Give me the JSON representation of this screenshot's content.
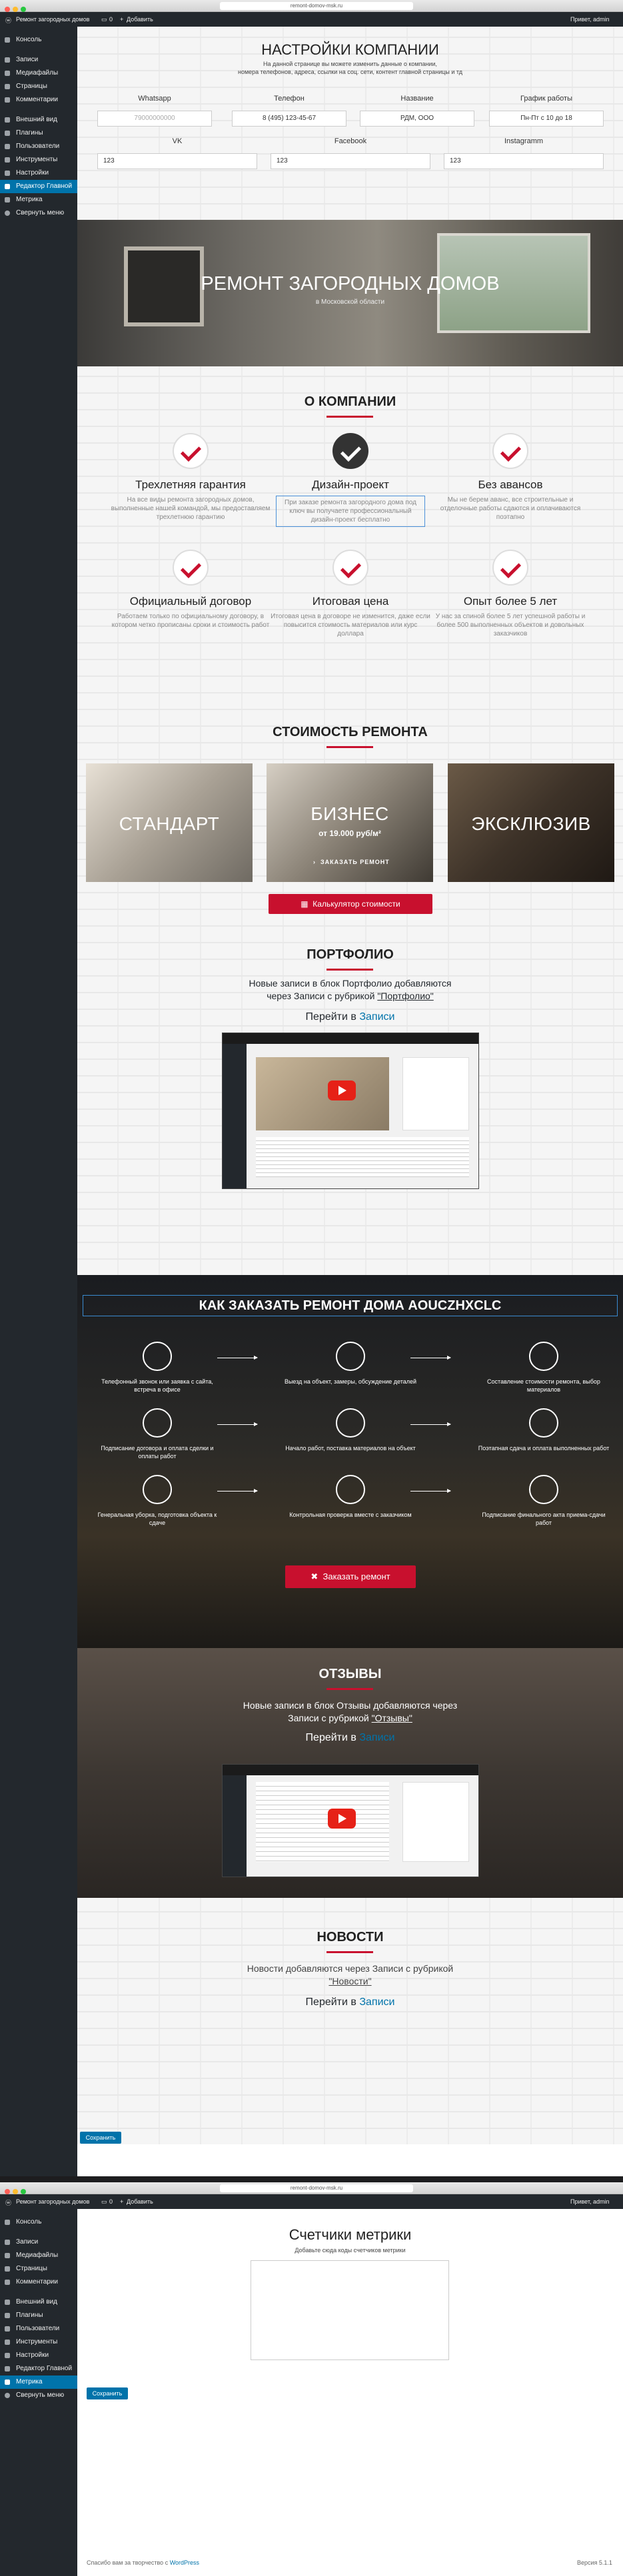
{
  "browser": {
    "url_top": "remont-domov-msk.ru",
    "url_bottom": "remont-domov-msk.ru"
  },
  "adminbar": {
    "site": "Ремонт загородных домов",
    "comments": "0",
    "add": "Добавить",
    "greeting": "Привет, admin"
  },
  "sidebar": {
    "items": [
      "Консоль",
      "Записи",
      "Медиафайлы",
      "Страницы",
      "Комментарии",
      "Внешний вид",
      "Плагины",
      "Пользователи",
      "Инструменты",
      "Настройки",
      "Редактор Главной",
      "Метрика",
      "Свернуть меню"
    ],
    "active_top": "Редактор Главной",
    "active_bottom": "Метрика"
  },
  "settings": {
    "title": "НАСТРОЙКИ КОМПАНИИ",
    "desc1": "На данной странице вы можете изменить данные о компании,",
    "desc2": "номера телефонов, адреса, ссылки на соц. сети, контент главной страницы и тд",
    "labels": [
      "Whatsapp",
      "Телефон",
      "Название",
      "График работы"
    ],
    "values": [
      "79000000000",
      "8 (495) 123-45-67",
      "РДМ, ООО",
      "Пн-Пт с 10 до 18"
    ],
    "social_labels": [
      "VK",
      "Facebook",
      "Instagramm"
    ],
    "social_values": [
      "123",
      "123",
      "123"
    ]
  },
  "hero": {
    "title": "РЕМОНТ ЗАГОРОДНЫХ ДОМОВ",
    "subtitle": "в Московской области"
  },
  "about": {
    "title": "О КОМПАНИИ",
    "features": [
      {
        "title": "Трехлетняя гарантия",
        "text": "На все виды ремонта загородных домов, выполненные нашей командой, мы предоставляем трехлетнюю гарантию"
      },
      {
        "title": "Дизайн-проект",
        "text": "При заказе ремонта загородного дома под ключ вы получаете профессиональный дизайн-проект бесплатно"
      },
      {
        "title": "Без авансов",
        "text": "Мы не берем аванс, все строительные и отделочные работы сдаются и оплачиваются поэтапно"
      },
      {
        "title": "Официальный договор",
        "text": "Работаем только по официальному договору, в котором четко прописаны сроки и стоимость работ"
      },
      {
        "title": "Итоговая цена",
        "text": "Итоговая цена в договоре не изменится, даже если повысится стоимость материалов или курс доллара"
      },
      {
        "title": "Опыт более 5 лет",
        "text": "У нас за спиной более 5 лет успешной работы и более 500 выполненных объектов и довольных заказчиков"
      }
    ]
  },
  "prices": {
    "title": "СТОИМОСТЬ РЕМОНТА",
    "cards": [
      "СТАНДАРТ",
      "БИЗНЕС",
      "ЭКСКЛЮЗИВ"
    ],
    "business_price": "от 19.000 руб/м²",
    "order_label": "ЗАКАЗАТЬ РЕМОНТ",
    "calc_button": "Калькулятор стоимости"
  },
  "portfolio": {
    "title": "ПОРТФОЛИО",
    "text1": "Новые записи в блок Портфолио добавляются",
    "text2_prefix": "через Записи с рубрикой ",
    "text2_link": "\"Портфолио\"",
    "goto_prefix": "Перейти в ",
    "goto_link": "Записи"
  },
  "how": {
    "title": "КАК ЗАКАЗАТЬ РЕМОНТ ДОМА AOUCZHXCLC",
    "steps": [
      "Телефонный звонок или заявка с сайта, встреча в офисе",
      "Выезд на объект, замеры, обсуждение деталей",
      "Составление стоимости ремонта, выбор материалов",
      "Подписание договора и оплата сделки и оплаты работ",
      "Начало работ, поставка материалов на объект",
      "Поэтапная сдача и оплата выполненных работ",
      "Генеральная уборка, подготовка объекта к сдаче",
      "Контрольная проверка вместе с заказчиком",
      "Подписание финального акта приема-сдачи работ"
    ],
    "button": "Заказать ремонт"
  },
  "reviews": {
    "title": "ОТЗЫВЫ",
    "text1": "Новые записи в блок Отзывы добавляются через",
    "text2_prefix": "Записи с рубрикой ",
    "text2_link": "\"Отзывы\"",
    "goto_prefix": "Перейти в ",
    "goto_link": "Записи"
  },
  "news": {
    "title": "НОВОСТИ",
    "text1": "Новости добавляются через Записи с рубрикой",
    "text2": "\"Новости\"",
    "goto_prefix": "Перейти в ",
    "goto_link": "Записи"
  },
  "save_label": "Сохранить",
  "footer": {
    "thanks_prefix": "Спасибо вам за творчество с ",
    "wp": "WordPress",
    "version": "Версия 5.1.1"
  },
  "metrics": {
    "title": "Счетчики метрики",
    "desc": "Добавьте сюда коды счетчиков метрики"
  },
  "colors": {
    "accent_red": "#c8102e",
    "wp_blue": "#0073aa",
    "admin_dark": "#23282d"
  }
}
